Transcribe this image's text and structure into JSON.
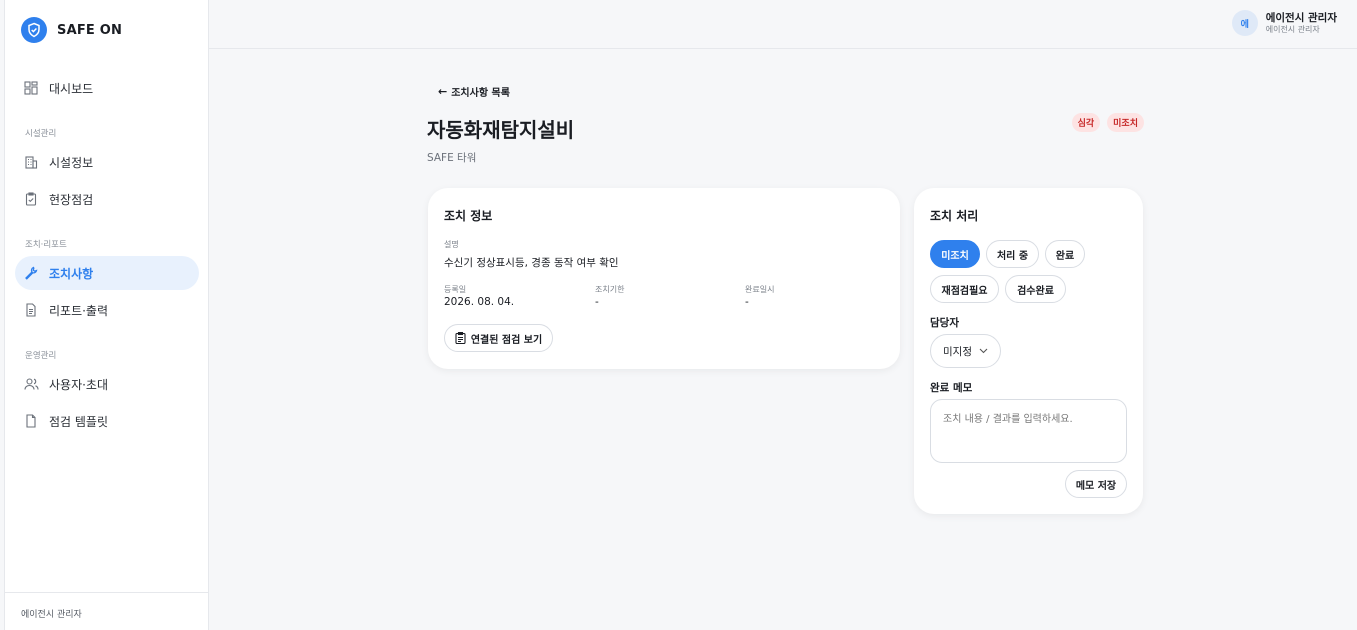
{
  "brand": {
    "name": "SAFE ON",
    "logo_icon": "shield-check-icon",
    "accent": "#2f80ed"
  },
  "sidebar": {
    "items": [
      {
        "label": "대시보드",
        "icon": "grid-icon"
      },
      {
        "label": "시설정보",
        "icon": "building-icon"
      },
      {
        "label": "현장점검",
        "icon": "clipboard-check-icon"
      },
      {
        "label": "조치사항",
        "icon": "wrench-icon",
        "active": true
      },
      {
        "label": "리포트·출력",
        "icon": "document-icon"
      },
      {
        "label": "사용자·초대",
        "icon": "users-icon"
      },
      {
        "label": "점검 템플릿",
        "icon": "file-template-icon"
      }
    ],
    "sections": [
      "시설관리",
      "조치·리포트",
      "운영관리"
    ],
    "footer": "에이전시 관리자"
  },
  "header": {
    "avatar_text": "에",
    "user_name": "에이전시 관리자",
    "user_role": "에이전시 관리자"
  },
  "page": {
    "back_label": "조치사항 목록",
    "title": "자동화재탐지설비",
    "subtitle": "SAFE 타워",
    "badges": [
      "심각",
      "미조치"
    ]
  },
  "info_card": {
    "title": "조치 정보",
    "description_label": "설명",
    "description": "수신기 정상표시등, 경종 동작 여부 확인",
    "registered_label": "등록일",
    "registered": "2026. 08. 04.",
    "deadline_label": "조치기한",
    "deadline": "-",
    "completed_label": "완료일시",
    "completed": "-",
    "linked_button": "연결된 점검 보기"
  },
  "action_card": {
    "title": "조치 처리",
    "statuses": [
      "미조치",
      "처리 중",
      "완료",
      "재점검필요",
      "검수완료"
    ],
    "active_status": "미조치",
    "assignee_label": "담당자",
    "assignee_value": "미지정",
    "memo_label": "완료 메모",
    "memo_placeholder": "조치 내용 / 결과를 입력하세요.",
    "save_button": "메모 저장"
  }
}
